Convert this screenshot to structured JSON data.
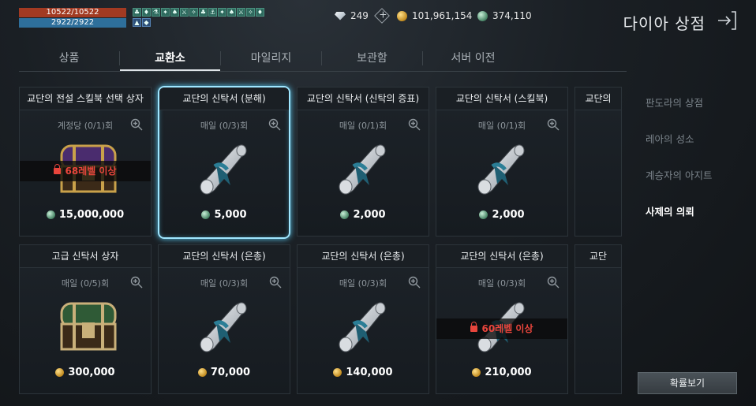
{
  "status": {
    "hp": "10522/10522",
    "mp": "2922/2922"
  },
  "currency": {
    "diamond": "249",
    "gold": "101,961,154",
    "green": "374,110"
  },
  "shop_title": "다이아 상점",
  "tabs": [
    "상품",
    "교환소",
    "마일리지",
    "보관함",
    "서버 이전"
  ],
  "active_tab": "교환소",
  "side_menu": [
    "판도라의 상점",
    "레아의 성소",
    "계승자의 아지트",
    "사제의 의뢰"
  ],
  "active_side": "사제의 의뢰",
  "prob_button": "확률보기",
  "items": [
    {
      "title": "교단의 전설 스킬북 선택 상자",
      "limit": "계정당 (0/1)회",
      "price": "15,000,000",
      "currency": "green",
      "icon": "purple-chest-icon",
      "lock": "68레벨 이상"
    },
    {
      "title": "교단의 신탁서 (분해)",
      "limit": "매일 (0/3)회",
      "price": "5,000",
      "currency": "green",
      "icon": "scroll-icon",
      "selected": true
    },
    {
      "title": "교단의 신탁서 (신탁의 증표)",
      "limit": "매일 (0/1)회",
      "price": "2,000",
      "currency": "green",
      "icon": "scroll-icon"
    },
    {
      "title": "교단의 신탁서 (스킬북)",
      "limit": "매일 (0/1)회",
      "price": "2,000",
      "currency": "green",
      "icon": "scroll-icon"
    },
    {
      "title": "교단의",
      "limit": "",
      "price": "",
      "currency": "",
      "icon": ""
    },
    {
      "title": "고급 신탁서 상자",
      "limit": "매일 (0/5)회",
      "price": "300,000",
      "currency": "gold",
      "icon": "green-chest-icon"
    },
    {
      "title": "교단의 신탁서 (은총)",
      "limit": "매일 (0/3)회",
      "price": "70,000",
      "currency": "gold",
      "icon": "scroll-icon"
    },
    {
      "title": "교단의 신탁서 (은총)",
      "limit": "매일 (0/3)회",
      "price": "140,000",
      "currency": "gold",
      "icon": "scroll-icon"
    },
    {
      "title": "교단의 신탁서 (은총)",
      "limit": "매일 (0/3)회",
      "price": "210,000",
      "currency": "gold",
      "icon": "scroll-icon",
      "lock": "60레벨 이상"
    },
    {
      "title": "교단",
      "limit": "",
      "price": "",
      "currency": "",
      "icon": ""
    }
  ]
}
